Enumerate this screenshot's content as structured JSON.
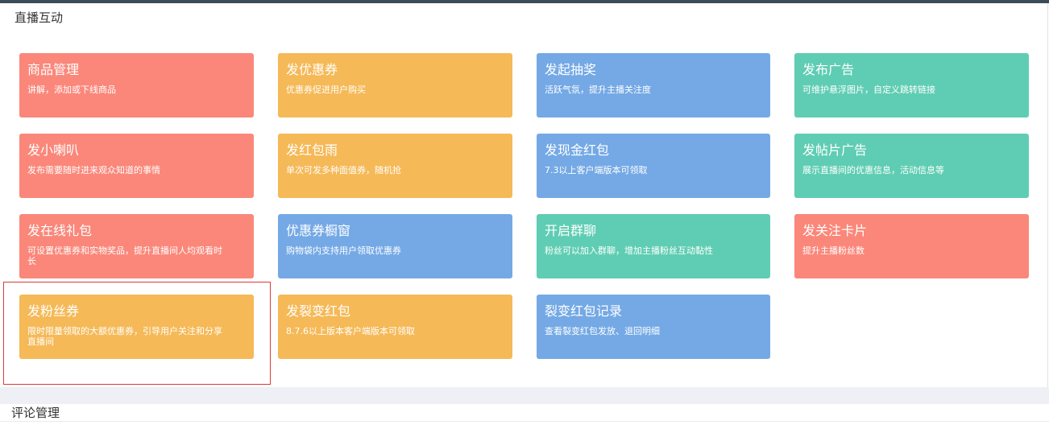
{
  "sections": {
    "live_interaction": "直播互动",
    "comment_management": "评论管理"
  },
  "cards": [
    {
      "title": "商品管理",
      "desc": "讲解，添加或下线商品",
      "color": "#fa877a"
    },
    {
      "title": "发优惠券",
      "desc": "优惠券促进用户购买",
      "color": "#f5b957"
    },
    {
      "title": "发起抽奖",
      "desc": "活跃气氛，提升主播关注度",
      "color": "#74a9e5"
    },
    {
      "title": "发布广告",
      "desc": "可维护悬浮图片，自定义跳转链接",
      "color": "#5fcdb3"
    },
    {
      "title": "发小喇叭",
      "desc": "发布需要随时进来观众知道的事情",
      "color": "#fa877a"
    },
    {
      "title": "发红包雨",
      "desc": "单次可发多种面值券，随机抢",
      "color": "#f5b957"
    },
    {
      "title": "发现金红包",
      "desc": "7.3以上客户端版本可领取",
      "color": "#74a9e5"
    },
    {
      "title": "发帖片广告",
      "desc": "展示直播间的优惠信息，活动信息等",
      "color": "#5fcdb3"
    },
    {
      "title": "发在线礼包",
      "desc": "可设置优惠券和实物奖品，提升直播间人均观看时长",
      "color": "#fa877a"
    },
    {
      "title": "优惠券橱窗",
      "desc": "购物袋内支持用户领取优惠券",
      "color": "#74a9e5"
    },
    {
      "title": "开启群聊",
      "desc": "粉丝可以加入群聊，增加主播粉丝互动黏性",
      "color": "#5fcdb3"
    },
    {
      "title": "发关注卡片",
      "desc": "提升主播粉丝数",
      "color": "#fa877a"
    },
    {
      "title": "发粉丝券",
      "desc": "限时限量领取的大额优惠券，引导用户关注和分享直播间",
      "color": "#f5b957"
    },
    {
      "title": "发裂变红包",
      "desc": "8.7.6以上版本客户端版本可领取",
      "color": "#f5b957"
    },
    {
      "title": "裂变红包记录",
      "desc": "查看裂变红包发放、退回明细",
      "color": "#74a9e5"
    }
  ]
}
